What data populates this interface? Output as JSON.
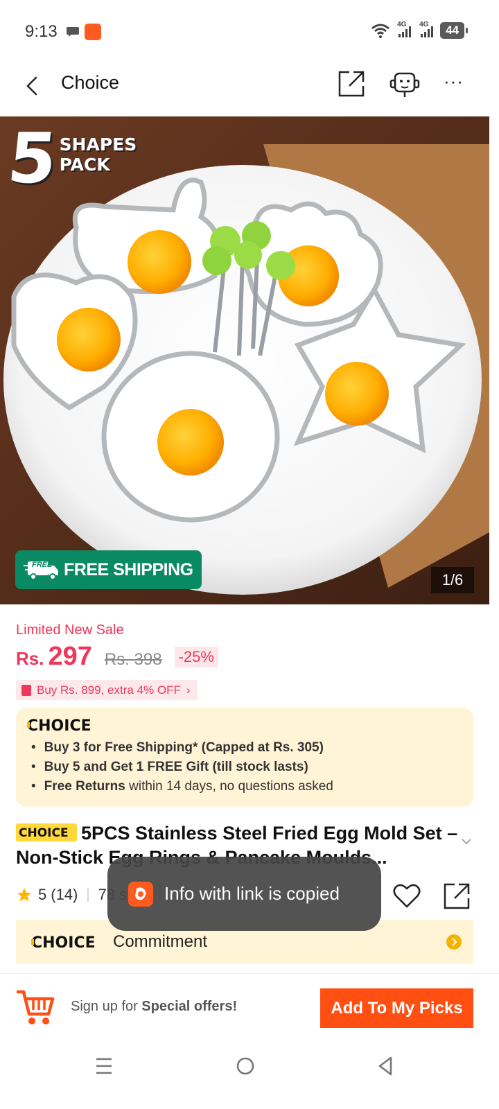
{
  "status_bar": {
    "time": "9:13",
    "network_1": "4G",
    "network_2": "4G",
    "battery": "44"
  },
  "header": {
    "title": "Choice"
  },
  "hero": {
    "badge_number": "5",
    "badge_line1": "SHAPES",
    "badge_line2": "PACK",
    "free_icon_text": "FREE",
    "free_shipping": "FREE SHIPPING",
    "counter": "1/6"
  },
  "pricing": {
    "sale_label": "Limited New Sale",
    "currency": "Rs.",
    "price": "297",
    "old_price": "Rs. 398",
    "discount": "-25%",
    "promo": "Buy Rs. 899, extra 4% OFF"
  },
  "choice": {
    "logo": "CHOICE",
    "items": [
      {
        "bold": "Buy 3 for  Free Shipping* (Capped at Rs. 305)",
        "rest": ""
      },
      {
        "bold": "Buy 5 and Get 1 FREE Gift (till stock lasts)",
        "rest": ""
      },
      {
        "bold": "Free Returns",
        "rest": " within 14 days, no questions asked"
      }
    ]
  },
  "product": {
    "tag": "CHOICE",
    "title": "5PCS Stainless Steel Fried Egg Mold Set – Non-Stick Egg Rings & Pancake Moulds...",
    "rating": "5",
    "reviews": "(14)",
    "sold": "78 s"
  },
  "commitment": {
    "logo": "CHOICE",
    "label": "Commitment"
  },
  "toast": {
    "message": "Info with link is copied"
  },
  "bottom_bar": {
    "signup_prefix": "Sign up for ",
    "signup_bold": "Special offers!",
    "add_button": "Add To My Picks"
  },
  "colors": {
    "accent": "#ff4f12",
    "sale": "#f0365a",
    "choice_bg": "#fff4d6",
    "free_ship": "#0a8a62"
  }
}
